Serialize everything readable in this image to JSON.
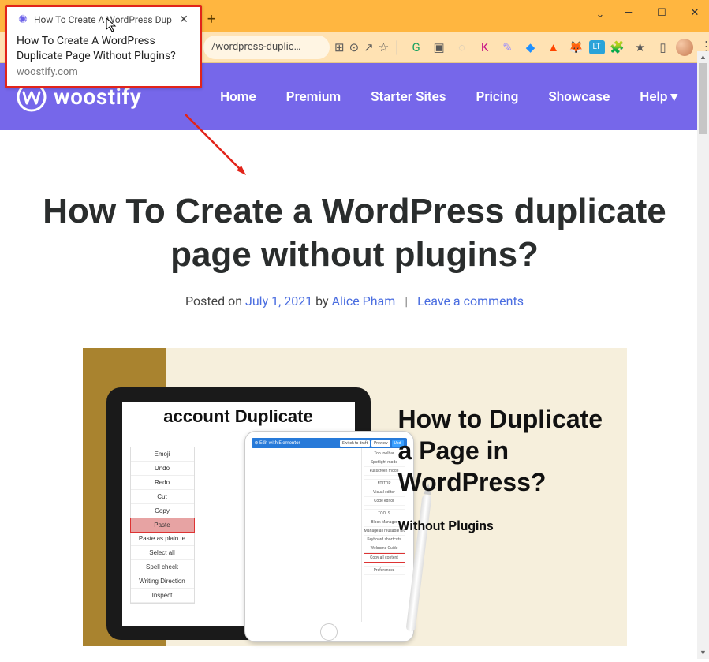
{
  "browser": {
    "tab_title": "How To Create A WordPress Dup",
    "tooltip_title": "How To Create A WordPress Duplicate Page Without Plugins?",
    "tooltip_domain": "woostify.com",
    "url_fragment": "/wordpress-duplic…"
  },
  "ext_icons": [
    "G",
    "▣",
    "◌",
    "K",
    "✎",
    "◆",
    "▲",
    "🦊",
    "LT",
    "🧩",
    "★",
    "▯"
  ],
  "site": {
    "brand": "woostify",
    "nav": {
      "home": "Home",
      "premium": "Premium",
      "starter": "Starter Sites",
      "pricing": "Pricing",
      "showcase": "Showcase",
      "help": "Help"
    }
  },
  "article": {
    "heading": "How To Create a WordPress duplicate page without plugins?",
    "posted_on_label": "Posted on ",
    "date": "July 1, 2021",
    "by_label": " by ",
    "author": "Alice Pham",
    "comments": "Leave a comments"
  },
  "hero": {
    "ipad_title": "account Duplicate",
    "context_menu": [
      "Emoji",
      "Undo",
      "Redo",
      "Cut",
      "Copy",
      "Paste",
      "Paste as plain te",
      "Select all",
      "Spell check",
      "Writing Direction",
      "Inspect"
    ],
    "mini_toolbar_label": "Edit with Elementor",
    "mini_toolbar_right": [
      "Switch to draft",
      "Preview",
      "Upd"
    ],
    "mini_side": [
      "Top toolbar",
      "Spotlight mode",
      "Fullscreen mode",
      "",
      "EDITOR",
      "Visual editor",
      "Code editor",
      "",
      "TOOLS",
      "Block Manager",
      "Manage all reusable blocks",
      "Keyboard shortcuts",
      "Welcome Guide",
      "Copy all content",
      "",
      "Preferences"
    ],
    "heading": "How to Duplicate a Page in WordPress?",
    "sub": "Without Plugins"
  }
}
